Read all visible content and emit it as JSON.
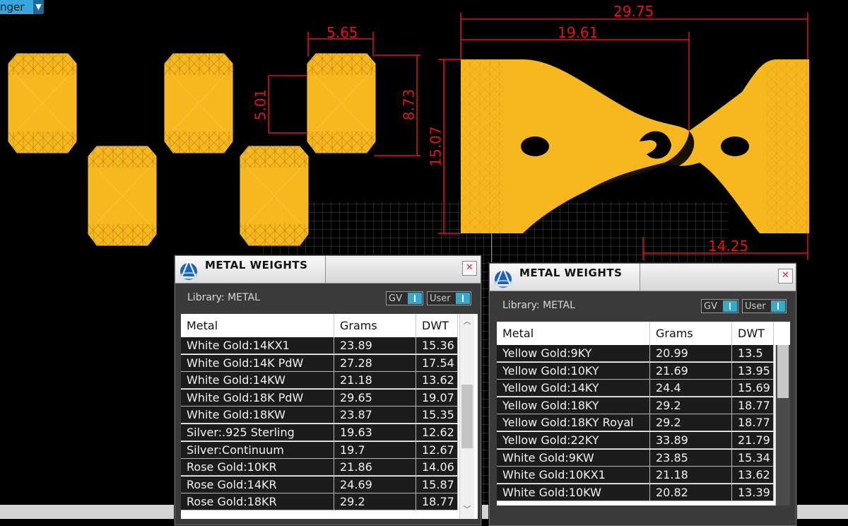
{
  "mode_selector": {
    "label": "nger",
    "arrow_icon": "triangle-down-icon"
  },
  "dimensions": {
    "width_565": "5.65",
    "height_501": "5.01",
    "height_873": "8.73",
    "total_2975": "29.75",
    "width_1961": "19.61",
    "height_1507": "15.07",
    "width_1425": "14.25"
  },
  "colors": {
    "gem_gold": "#f7b81f",
    "dimension_red": "#e0141a",
    "accent_teal": "#39a9c9"
  },
  "panel_left": {
    "title": "METAL WEIGHTS",
    "library_label": "Library: METAL",
    "toggle_gv": "GV",
    "toggle_user": "User",
    "columns": [
      "Metal",
      "Grams",
      "DWT"
    ],
    "rows": [
      [
        "White Gold:14KX1",
        "23.89",
        "15.36"
      ],
      [
        "White Gold:14K PdW",
        "27.28",
        "17.54"
      ],
      [
        "White Gold:14KW",
        "21.18",
        "13.62"
      ],
      [
        "White Gold:18K PdW",
        "29.65",
        "19.07"
      ],
      [
        "White Gold:18KW",
        "23.87",
        "15.35"
      ],
      [
        "Silver:.925 Sterling",
        "19.63",
        "12.62"
      ],
      [
        "Silver:Continuum",
        "19.7",
        "12.67"
      ],
      [
        "Rose Gold:10KR",
        "21.86",
        "14.06"
      ],
      [
        "Rose Gold:14KR",
        "24.69",
        "15.87"
      ],
      [
        "Rose Gold:18KR",
        "29.2",
        "18.77"
      ]
    ]
  },
  "panel_right": {
    "title": "METAL WEIGHTS",
    "library_label": "Library: METAL",
    "toggle_gv": "GV",
    "toggle_user": "User",
    "columns": [
      "Metal",
      "Grams",
      "DWT"
    ],
    "rows": [
      [
        "Yellow Gold:9KY",
        "20.99",
        "13.5"
      ],
      [
        "Yellow Gold:10KY",
        "21.69",
        "13.95"
      ],
      [
        "Yellow Gold:14KY",
        "24.4",
        "15.69"
      ],
      [
        "Yellow Gold:18KY",
        "29.2",
        "18.77"
      ],
      [
        "Yellow Gold:18KY Royal",
        "29.2",
        "18.77"
      ],
      [
        "Yellow Gold:22KY",
        "33.89",
        "21.79"
      ],
      [
        "White Gold:9KW",
        "23.85",
        "15.34"
      ],
      [
        "White Gold:10KX1",
        "21.18",
        "13.62"
      ],
      [
        "White Gold:10KW",
        "20.82",
        "13.39"
      ]
    ]
  }
}
